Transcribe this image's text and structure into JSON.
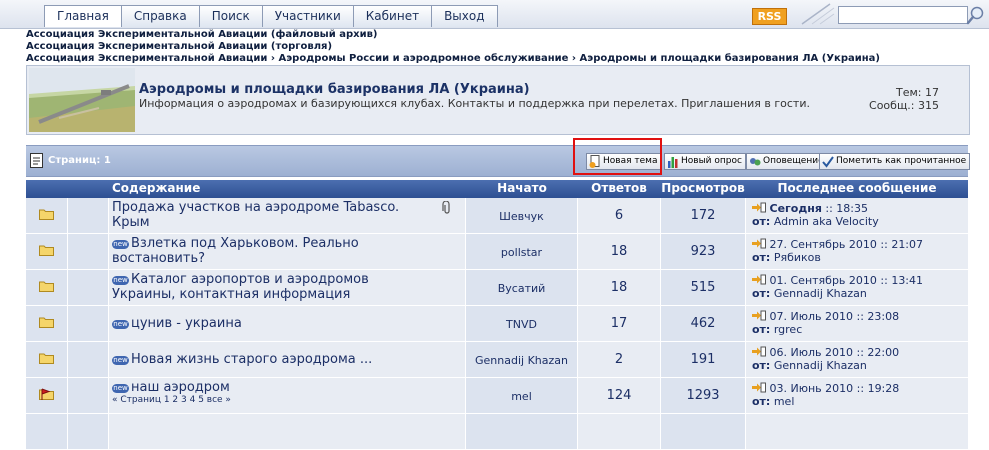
{
  "menu": {
    "tabs": [
      "Главная",
      "Справка",
      "Поиск",
      "Участники",
      "Кабинет",
      "Выход"
    ],
    "rss": "RSS",
    "search_value": ""
  },
  "breadcrumbs": [
    "Ассоциация Экспериментальной Авиации (файловый архив)",
    "Ассоциация Экспериментальной Авиации (торговля)",
    "Ассоциация Экспериментальной Авиации › Аэродромы России и аэродромное обслуживание › Аэродромы и площадки базирования ЛА (Украина)"
  ],
  "forum": {
    "title": "Аэродромы и площадки базирования ЛА (Украина)",
    "description": "Информация о аэродромах и базирующихся клубах. Контакты и поддержка при перелетах. Приглашения в гости.",
    "topics": "Тем: 17",
    "posts": "Сообщ.: 315"
  },
  "toolbar": {
    "pages": "Страниц: 1",
    "new_topic": "Новая тема",
    "new_poll": "Новый опрос",
    "notify": "Оповещение",
    "mark_read": "Пометить как прочитанное"
  },
  "table": {
    "headers": [
      "Содержание",
      "Начато",
      "Ответов",
      "Просмотров",
      "Последнее сообщение"
    ],
    "rows": [
      {
        "title": "Продажа участков на аэродроме Tabasco. Крым",
        "new": "",
        "author": "Шевчук",
        "replies": "6",
        "views": "172",
        "last_date": "Сегодня",
        "last_time": ":: 18:35",
        "last_from": "от:",
        "last_user": "Admin aka Velocity",
        "pages": ""
      },
      {
        "title": "Взлетка под Харьковом. Реально востановить?",
        "new": "new",
        "author": "pollstar",
        "replies": "18",
        "views": "923",
        "last_date": "27. Сентябрь 2010",
        "last_time": ":: 21:07",
        "last_from": "от:",
        "last_user": "Рябиков",
        "pages": ""
      },
      {
        "title": "Каталог аэропортов и аэродромов Украины, контактная информация",
        "new": "new",
        "author": "Вусатий",
        "replies": "18",
        "views": "515",
        "last_date": "01. Сентябрь 2010",
        "last_time": ":: 13:41",
        "last_from": "от:",
        "last_user": "Gennadij Khazan",
        "pages": ""
      },
      {
        "title": "цунив - украина",
        "new": "new",
        "author": "TNVD",
        "replies": "17",
        "views": "462",
        "last_date": "07. Июль 2010",
        "last_time": ":: 23:08",
        "last_from": "от:",
        "last_user": "rgrec",
        "pages": ""
      },
      {
        "title": "Новая жизнь старого аэродрома ...",
        "new": "new",
        "author": "Gennadij Khazan",
        "replies": "2",
        "views": "191",
        "last_date": "06. Июль 2010",
        "last_time": ":: 22:00",
        "last_from": "от:",
        "last_user": "Gennadij Khazan",
        "pages": ""
      },
      {
        "title": "наш аэродром",
        "new": "new",
        "author": "mel",
        "replies": "124",
        "views": "1293",
        "last_date": "03. Июнь 2010",
        "last_time": ":: 19:28",
        "last_from": "от:",
        "last_user": "mel",
        "pages": "« Страниц 1 2 3 4 5 все »"
      }
    ]
  }
}
